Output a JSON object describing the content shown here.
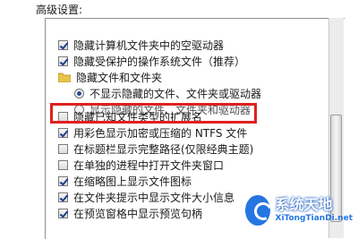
{
  "section_title": "高级设置:",
  "items": [
    {
      "kind": "checkbox",
      "checked": true,
      "label": "隐藏计算机文件夹中的空驱动器"
    },
    {
      "kind": "checkbox",
      "checked": true,
      "label": "隐藏受保护的操作系统文件（推荐）"
    },
    {
      "kind": "folder",
      "label": "隐藏文件和文件夹"
    },
    {
      "kind": "radio",
      "checked": true,
      "label": "不显示隐藏的文件、文件夹或驱动器"
    },
    {
      "kind": "radio",
      "checked": false,
      "label": "显示隐藏的文件、文件夹和驱动器"
    },
    {
      "kind": "checkbox",
      "checked": false,
      "label": "隐藏已知文件类型的扩展名"
    },
    {
      "kind": "checkbox",
      "checked": true,
      "label": "用彩色显示加密或压缩的 NTFS 文件"
    },
    {
      "kind": "checkbox",
      "checked": false,
      "label": "在标题栏显示完整路径(仅限经典主题)"
    },
    {
      "kind": "checkbox",
      "checked": false,
      "label": "在单独的进程中打开文件夹窗口"
    },
    {
      "kind": "checkbox",
      "checked": true,
      "label": "在缩略图上显示文件图标"
    },
    {
      "kind": "checkbox",
      "checked": true,
      "label": "在文件夹提示中显示文件大小信息"
    },
    {
      "kind": "checkbox",
      "checked": true,
      "label": "在预览窗格中显示预览句柄"
    }
  ],
  "watermark": {
    "cn": "系统天地",
    "en": "XiTongTianDi.net"
  },
  "colors": {
    "highlight": "#e02020",
    "accent": "#1b6fe0"
  }
}
